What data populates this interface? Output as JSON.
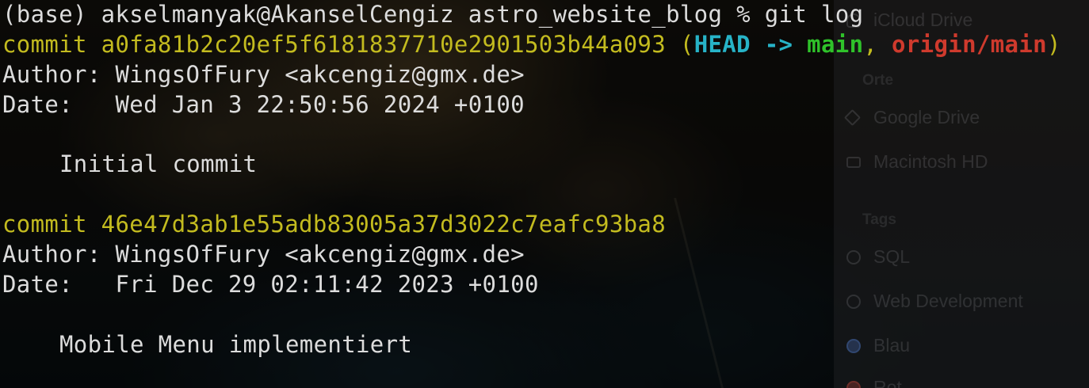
{
  "finder_sidebar": {
    "icloud_item": "iCloud Drive",
    "locations_heading": "Orte",
    "locations": [
      "Google Drive",
      "Macintosh HD"
    ],
    "tags_heading": "Tags",
    "tags": [
      "SQL",
      "Web Development",
      "Blau",
      "Rot"
    ]
  },
  "terminal": {
    "prompt": {
      "env": "(base)",
      "user_host": "akselmanyak@AkanselCengiz",
      "cwd": "astro_website_blog",
      "symbol": "%",
      "command": "git log"
    },
    "commits": [
      {
        "commit_label": "commit",
        "hash": "a0fa81b2c20ef5f6181837710e2901503b44a093",
        "refs": {
          "open": "(",
          "head": "HEAD ->",
          "branch": "main",
          "sep": ",",
          "remote": "origin/main",
          "close": ")"
        },
        "author_label": "Author:",
        "author": "WingsOfFury <akcengiz@gmx.de>",
        "date_label": "Date:",
        "date": "Wed Jan 3 22:50:56 2024 +0100",
        "message": "Initial commit"
      },
      {
        "commit_label": "commit",
        "hash": "46e47d3ab1e55adb83005a37d3022c7eafc93ba8",
        "author_label": "Author:",
        "author": "WingsOfFury <akcengiz@gmx.de>",
        "date_label": "Date:",
        "date": "Fri Dec 29 02:11:42 2023 +0100",
        "message": "Mobile Menu implementiert"
      }
    ]
  },
  "colors": {
    "commit_hash": "#c3bb1f",
    "head": "#27b3c7",
    "branch": "#2fc22a",
    "remote": "#cf3a2d",
    "text": "#dcdcdc"
  }
}
